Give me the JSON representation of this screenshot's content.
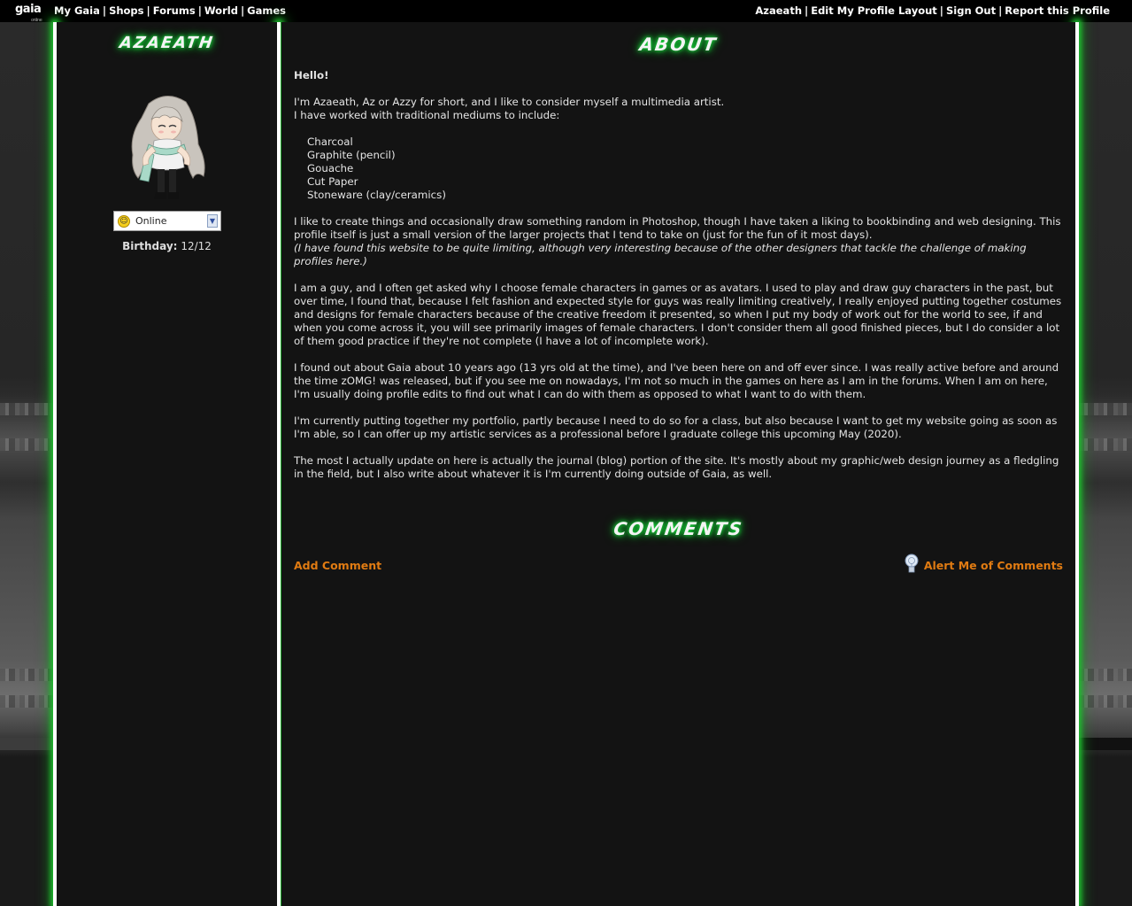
{
  "nav": {
    "logo": "gaia",
    "logo_sub": "online",
    "left_links": [
      "My Gaia",
      "Shops",
      "Forums",
      "World",
      "Games"
    ],
    "right_links": [
      "Azaeath",
      "Edit My Profile Layout",
      "Sign Out",
      "Report this Profile"
    ],
    "separator": "|"
  },
  "sidebar": {
    "username_heading": "Azaeath",
    "status_selected": "Online",
    "birthday_label": "Birthday:",
    "birthday_value": "12/12"
  },
  "about": {
    "heading": "About",
    "greeting": "Hello!",
    "intro_line1": "I'm Azaeath, Az or Azzy for short, and I like to consider myself a multimedia artist.",
    "intro_line2": "I have worked with traditional mediums to include:",
    "mediums": [
      "Charcoal",
      "Graphite (pencil)",
      "Gouache",
      "Cut Paper",
      "Stoneware (clay/ceramics)"
    ],
    "para_create": "I like to create things and occasionally draw something random in Photoshop, though I have taken a liking to bookbinding and web designing. This profile itself is just a small version of the larger projects that I tend to take on (just for the fun of it most days).",
    "para_create_italic": "(I have found this website to be quite limiting, although very interesting because of the other designers that tackle the challenge of making profiles here.)",
    "para_guy": "I am a guy, and I often get asked why I choose female characters in games or as avatars. I used to play and draw guy characters in the past, but over time, I found that, because I felt fashion and expected style for guys was really limiting creatively, I really enjoyed putting together costumes and designs for female characters because of the creative freedom it presented, so when I put my body of work out for the world to see, if and when you come across it, you will see primarily images of female characters. I don't consider them all good finished pieces, but I do consider a lot of them good practice if they're not complete (I have a lot of incomplete work).",
    "para_gaia": "I found out about Gaia about 10 years ago (13 yrs old at the time), and I've been here on and off ever since. I was really active before and around the time zOMG! was released, but if you see me on nowadays, I'm not so much in the games on here as I am in the forums. When I am on here, I'm usually doing profile edits to find out what I can do with them as opposed to what I want to do with them.",
    "para_portfolio": "I'm currently putting together my portfolio, partly because I need to do so for a class, but also because I want to get my website going as soon as I'm able, so I can offer up my artistic services as a professional before I graduate college this upcoming May (2020).",
    "para_journal": "The most I actually update on here is actually the journal (blog) portion of the site. It's mostly about my graphic/web design journey as a fledgling in the field, but I also write about whatever it is I'm currently doing outside of Gaia, as well."
  },
  "comments": {
    "heading": "Comments",
    "add_comment": "Add Comment",
    "alert_me": "Alert Me of Comments"
  },
  "colors": {
    "glow": "#17d13a",
    "link_orange": "#e07b12",
    "panel_bg": "#131313"
  }
}
